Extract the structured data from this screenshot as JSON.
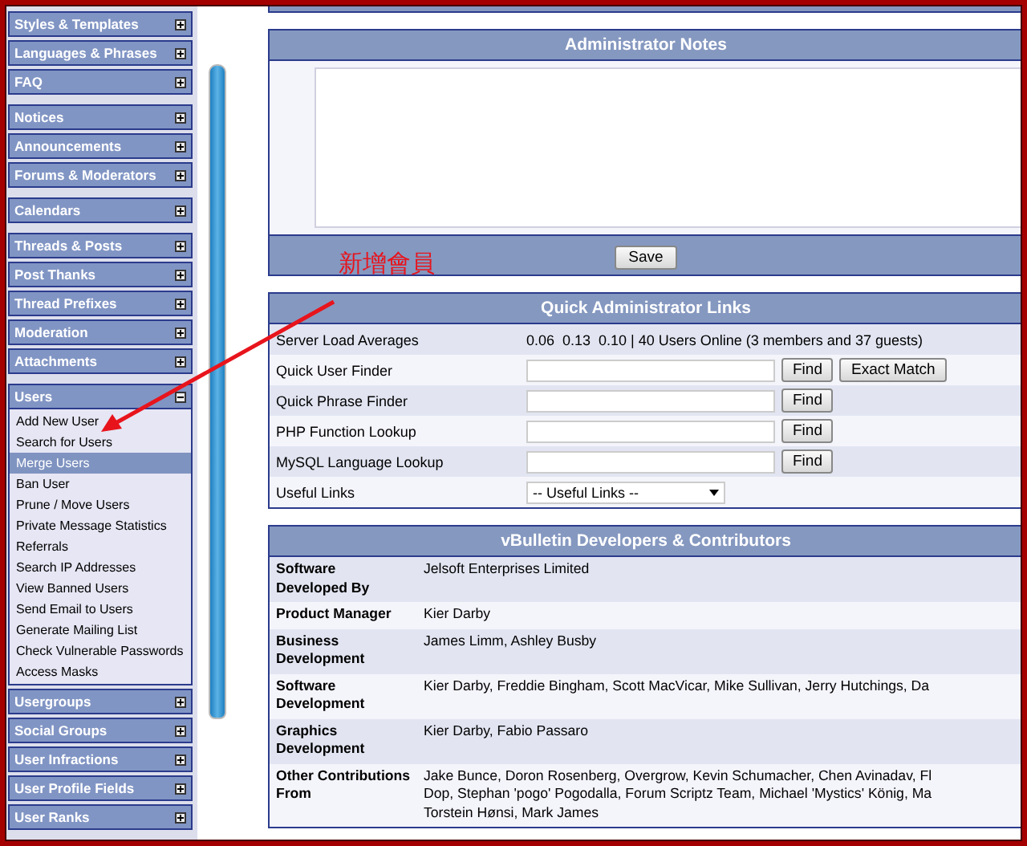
{
  "annotation": {
    "label": "新增會員"
  },
  "sidebar": {
    "groups": [
      [
        {
          "label": "Styles & Templates",
          "expanded": false
        },
        {
          "label": "Languages & Phrases",
          "expanded": false
        },
        {
          "label": "FAQ",
          "expanded": false
        }
      ],
      [
        {
          "label": "Notices",
          "expanded": false
        },
        {
          "label": "Announcements",
          "expanded": false
        },
        {
          "label": "Forums & Moderators",
          "expanded": false
        }
      ],
      [
        {
          "label": "Calendars",
          "expanded": false
        }
      ],
      [
        {
          "label": "Threads & Posts",
          "expanded": false
        },
        {
          "label": "Post Thanks",
          "expanded": false
        },
        {
          "label": "Thread Prefixes",
          "expanded": false
        },
        {
          "label": "Moderation",
          "expanded": false
        },
        {
          "label": "Attachments",
          "expanded": false
        }
      ],
      [
        {
          "label": "Users",
          "expanded": true,
          "links": [
            {
              "label": "Add New User",
              "selected": false
            },
            {
              "label": "Search for Users",
              "selected": false
            },
            {
              "label": "Merge Users",
              "selected": true
            },
            {
              "label": "Ban User",
              "selected": false
            },
            {
              "label": "Prune / Move Users",
              "selected": false
            },
            {
              "label": "Private Message Statistics",
              "selected": false
            },
            {
              "label": "Referrals",
              "selected": false
            },
            {
              "label": "Search IP Addresses",
              "selected": false
            },
            {
              "label": "View Banned Users",
              "selected": false
            },
            {
              "label": "Send Email to Users",
              "selected": false
            },
            {
              "label": "Generate Mailing List",
              "selected": false
            },
            {
              "label": "Check Vulnerable Passwords",
              "selected": false
            },
            {
              "label": "Access Masks",
              "selected": false
            }
          ]
        },
        {
          "label": "Usergroups",
          "expanded": false
        },
        {
          "label": "Social Groups",
          "expanded": false
        },
        {
          "label": "User Infractions",
          "expanded": false
        },
        {
          "label": "User Profile Fields",
          "expanded": false
        },
        {
          "label": "User Ranks",
          "expanded": false
        }
      ]
    ]
  },
  "admin_notes": {
    "title": "Administrator Notes",
    "button": "Save"
  },
  "quick_links": {
    "title": "Quick Administrator Links",
    "rows": [
      {
        "kind": "text",
        "label": "Server Load Averages",
        "value": "0.06  0.13  0.10 | 40 Users Online (3 members and 37 guests)"
      },
      {
        "kind": "finder",
        "label": "Quick User Finder",
        "buttons": [
          "Find",
          "Exact Match"
        ]
      },
      {
        "kind": "finder",
        "label": "Quick Phrase Finder",
        "buttons": [
          "Find"
        ]
      },
      {
        "kind": "finder",
        "label": "PHP Function Lookup",
        "buttons": [
          "Find"
        ]
      },
      {
        "kind": "finder",
        "label": "MySQL Language Lookup",
        "buttons": [
          "Find"
        ]
      },
      {
        "kind": "select",
        "label": "Useful Links",
        "value": "-- Useful Links --"
      }
    ]
  },
  "credits": {
    "title": "vBulletin Developers & Contributors",
    "rows": [
      {
        "label": "Software Developed By",
        "lines": [
          "Jelsoft Enterprises Limited"
        ]
      },
      {
        "label": "Product Manager",
        "lines": [
          "Kier Darby"
        ]
      },
      {
        "label": "Business Development",
        "lines": [
          "James Limm, Ashley Busby"
        ]
      },
      {
        "label": "Software Development",
        "lines": [
          "Kier Darby, Freddie Bingham, Scott MacVicar, Mike Sullivan, Jerry Hutchings, Da"
        ]
      },
      {
        "label": "Graphics Development",
        "lines": [
          "Kier Darby, Fabio Passaro"
        ]
      },
      {
        "label": "Other Contributions From",
        "lines": [
          "Jake Bunce, Doron Rosenberg, Overgrow, Kevin Schumacher, Chen Avinadav, Fl",
          "Dop, Stephan 'pogo' Pogodalla, Forum Scriptz Team, Michael 'Mystics' König, Ma",
          "Torstein Hønsi, Mark James"
        ]
      }
    ]
  }
}
